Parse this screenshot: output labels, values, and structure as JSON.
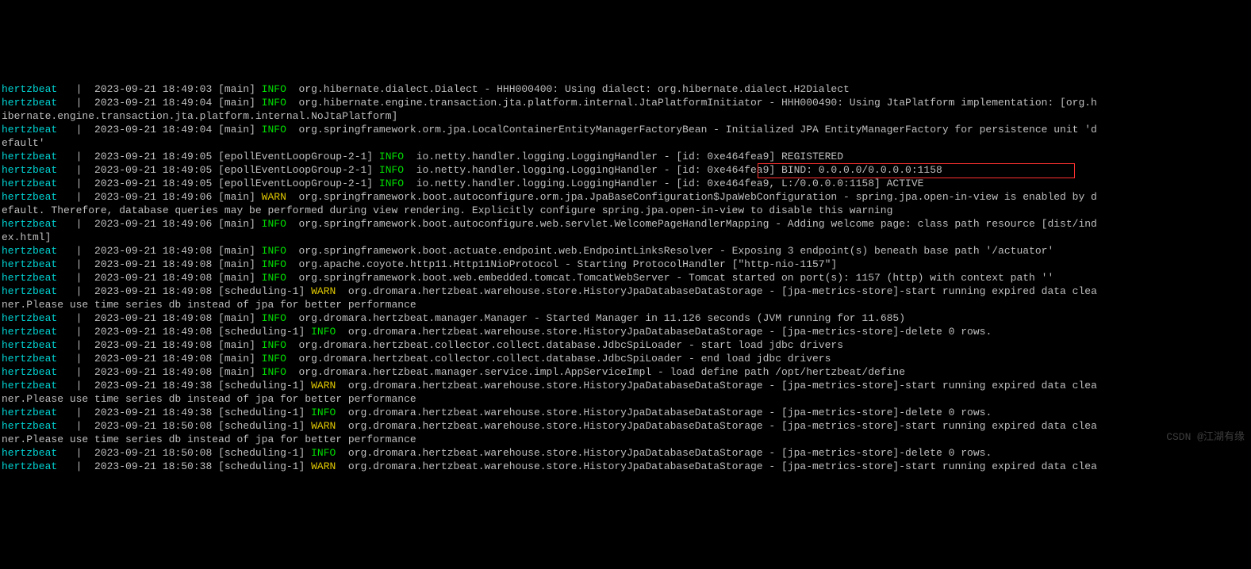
{
  "watermark": "CSDN @江湖有缘",
  "lines": [
    {
      "src": "hertzbeat",
      "ts": "2023-09-21 18:49:03",
      "thread": "[main]",
      "level": "INFO",
      "rest": "  org.hibernate.dialect.Dialect - HHH000400: Using dialect: org.hibernate.dialect.H2Dialect",
      "wrap": false
    },
    {
      "src": "hertzbeat",
      "ts": "2023-09-21 18:49:04",
      "thread": "[main]",
      "level": "INFO",
      "rest": "  org.hibernate.engine.transaction.jta.platform.internal.JtaPlatformInitiator - HHH000490: Using JtaPlatform implementation: [org.h",
      "wrap": true,
      "wraptext": "ibernate.engine.transaction.jta.platform.internal.NoJtaPlatform]"
    },
    {
      "src": "hertzbeat",
      "ts": "2023-09-21 18:49:04",
      "thread": "[main]",
      "level": "INFO",
      "rest": "  org.springframework.orm.jpa.LocalContainerEntityManagerFactoryBean - Initialized JPA EntityManagerFactory for persistence unit 'd",
      "wrap": true,
      "wraptext": "efault'"
    },
    {
      "src": "hertzbeat",
      "ts": "2023-09-21 18:49:05",
      "thread": "[epollEventLoopGroup-2-1]",
      "level": "INFO",
      "rest": "  io.netty.handler.logging.LoggingHandler - [id: 0xe464fea9] REGISTERED",
      "wrap": false
    },
    {
      "src": "hertzbeat",
      "ts": "2023-09-21 18:49:05",
      "thread": "[epollEventLoopGroup-2-1]",
      "level": "INFO",
      "rest": "  io.netty.handler.logging.LoggingHandler - [id: 0xe464fea9] BIND: 0.0.0.0/0.0.0.0:1158",
      "wrap": false
    },
    {
      "src": "hertzbeat",
      "ts": "2023-09-21 18:49:05",
      "thread": "[epollEventLoopGroup-2-1]",
      "level": "INFO",
      "rest": "  io.netty.handler.logging.LoggingHandler - [id: 0xe464fea9, L:/0.0.0.0:1158] ACTIVE",
      "wrap": false
    },
    {
      "src": "hertzbeat",
      "ts": "2023-09-21 18:49:06",
      "thread": "[main]",
      "level": "WARN",
      "rest": "  org.springframework.boot.autoconfigure.orm.jpa.JpaBaseConfiguration$JpaWebConfiguration - spring.jpa.open-in-view is enabled by d",
      "wrap": true,
      "wraptext": "efault. Therefore, database queries may be performed during view rendering. Explicitly configure spring.jpa.open-in-view to disable this warning"
    },
    {
      "src": "hertzbeat",
      "ts": "2023-09-21 18:49:06",
      "thread": "[main]",
      "level": "INFO",
      "rest": "  org.springframework.boot.autoconfigure.web.servlet.WelcomePageHandlerMapping - Adding welcome page: class path resource [dist/ind",
      "wrap": true,
      "wraptext": "ex.html]"
    },
    {
      "src": "hertzbeat",
      "ts": "2023-09-21 18:49:08",
      "thread": "[main]",
      "level": "INFO",
      "rest": "  org.springframework.boot.actuate.endpoint.web.EndpointLinksResolver - Exposing 3 endpoint(s) beneath base path '/actuator'",
      "wrap": false
    },
    {
      "src": "hertzbeat",
      "ts": "2023-09-21 18:49:08",
      "thread": "[main]",
      "level": "INFO",
      "rest": "  org.apache.coyote.http11.Http11NioProtocol - Starting ProtocolHandler [\"http-nio-1157\"]",
      "wrap": false
    },
    {
      "src": "hertzbeat",
      "ts": "2023-09-21 18:49:08",
      "thread": "[main]",
      "level": "INFO",
      "rest": "  org.springframework.boot.web.embedded.tomcat.TomcatWebServer - Tomcat started on port(s): 1157 (http) with context path ''",
      "wrap": false
    },
    {
      "src": "hertzbeat",
      "ts": "2023-09-21 18:49:08",
      "thread": "[scheduling-1]",
      "level": "WARN",
      "rest": "  org.dromara.hertzbeat.warehouse.store.HistoryJpaDatabaseDataStorage - [jpa-metrics-store]-start running expired data clea",
      "wrap": true,
      "wraptext": "ner.Please use time series db instead of jpa for better performance"
    },
    {
      "src": "hertzbeat",
      "ts": "2023-09-21 18:49:08",
      "thread": "[main]",
      "level": "INFO",
      "rest": "  org.dromara.hertzbeat.manager.Manager - Started Manager in 11.126 seconds (JVM running for 11.685)",
      "wrap": false
    },
    {
      "src": "hertzbeat",
      "ts": "2023-09-21 18:49:08",
      "thread": "[scheduling-1]",
      "level": "INFO",
      "rest": "  org.dromara.hertzbeat.warehouse.store.HistoryJpaDatabaseDataStorage - [jpa-metrics-store]-delete 0 rows.",
      "wrap": false
    },
    {
      "src": "hertzbeat",
      "ts": "2023-09-21 18:49:08",
      "thread": "[main]",
      "level": "INFO",
      "rest": "  org.dromara.hertzbeat.collector.collect.database.JdbcSpiLoader - start load jdbc drivers",
      "wrap": false
    },
    {
      "src": "hertzbeat",
      "ts": "2023-09-21 18:49:08",
      "thread": "[main]",
      "level": "INFO",
      "rest": "  org.dromara.hertzbeat.collector.collect.database.JdbcSpiLoader - end load jdbc drivers",
      "wrap": false
    },
    {
      "src": "hertzbeat",
      "ts": "2023-09-21 18:49:08",
      "thread": "[main]",
      "level": "INFO",
      "rest": "  org.dromara.hertzbeat.manager.service.impl.AppServiceImpl - load define path /opt/hertzbeat/define",
      "wrap": false
    },
    {
      "src": "hertzbeat",
      "ts": "2023-09-21 18:49:38",
      "thread": "[scheduling-1]",
      "level": "WARN",
      "rest": "  org.dromara.hertzbeat.warehouse.store.HistoryJpaDatabaseDataStorage - [jpa-metrics-store]-start running expired data clea",
      "wrap": true,
      "wraptext": "ner.Please use time series db instead of jpa for better performance"
    },
    {
      "src": "hertzbeat",
      "ts": "2023-09-21 18:49:38",
      "thread": "[scheduling-1]",
      "level": "INFO",
      "rest": "  org.dromara.hertzbeat.warehouse.store.HistoryJpaDatabaseDataStorage - [jpa-metrics-store]-delete 0 rows.",
      "wrap": false
    },
    {
      "src": "hertzbeat",
      "ts": "2023-09-21 18:50:08",
      "thread": "[scheduling-1]",
      "level": "WARN",
      "rest": "  org.dromara.hertzbeat.warehouse.store.HistoryJpaDatabaseDataStorage - [jpa-metrics-store]-start running expired data clea",
      "wrap": true,
      "wraptext": "ner.Please use time series db instead of jpa for better performance"
    },
    {
      "src": "hertzbeat",
      "ts": "2023-09-21 18:50:08",
      "thread": "[scheduling-1]",
      "level": "INFO",
      "rest": "  org.dromara.hertzbeat.warehouse.store.HistoryJpaDatabaseDataStorage - [jpa-metrics-store]-delete 0 rows.",
      "wrap": false
    },
    {
      "src": "hertzbeat",
      "ts": "2023-09-21 18:50:38",
      "thread": "[scheduling-1]",
      "level": "WARN",
      "rest": "  org.dromara.hertzbeat.warehouse.store.HistoryJpaDatabaseDataStorage - [jpa-metrics-store]-start running expired data clea",
      "wrap": false
    }
  ]
}
